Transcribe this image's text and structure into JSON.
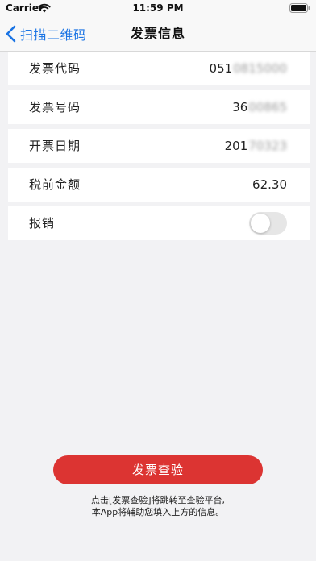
{
  "status_bar": {
    "carrier": "Carrier",
    "time": "11:59 PM",
    "icons": [
      "wifi-icon",
      "battery-icon"
    ]
  },
  "nav": {
    "back_label": "扫描二维码",
    "back_icon": "chevron-left-icon",
    "title": "发票信息",
    "accent_color": "#1a74e4"
  },
  "rows": [
    {
      "label": "发票代码",
      "value_visible": "051",
      "value_obscured": "0815000"
    },
    {
      "label": "发票号码",
      "value_visible": "36",
      "value_obscured": "00865"
    },
    {
      "label": "开票日期",
      "value_visible": "201",
      "value_obscured": "70323"
    },
    {
      "label": "税前金额",
      "value": "62.30"
    },
    {
      "label": "报销",
      "toggle_on": false
    }
  ],
  "action": {
    "verify_label": "发票查验",
    "button_color": "#dc3432",
    "hint_line1": "点击[发票查验]将跳转至查验平台,",
    "hint_line2": "本App将辅助您填入上方的信息。"
  }
}
